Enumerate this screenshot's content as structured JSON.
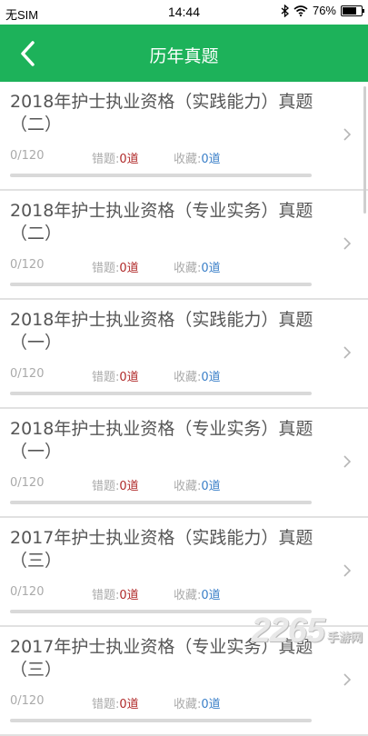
{
  "status": {
    "carrier": "无SIM",
    "time": "14:44",
    "battery": "76%",
    "battery_level": 0.76
  },
  "nav": {
    "title": "历年真题"
  },
  "list": {
    "wrong_label": "错题:",
    "fav_label": "收藏:",
    "items": [
      {
        "title": "2018年护士执业资格（实践能力）真题（二）",
        "progress": "0/120",
        "wrong": "0道",
        "fav": "0道"
      },
      {
        "title": "2018年护士执业资格（专业实务）真题（二）",
        "progress": "0/120",
        "wrong": "0道",
        "fav": "0道"
      },
      {
        "title": "2018年护士执业资格（实践能力）真题（一）",
        "progress": "0/120",
        "wrong": "0道",
        "fav": "0道"
      },
      {
        "title": "2018年护士执业资格（专业实务）真题（一）",
        "progress": "0/120",
        "wrong": "0道",
        "fav": "0道"
      },
      {
        "title": "2017年护士执业资格（实践能力）真题（三）",
        "progress": "0/120",
        "wrong": "0道",
        "fav": "0道"
      },
      {
        "title": "2017年护士执业资格（专业实务）真题（三）",
        "progress": "0/120",
        "wrong": "0道",
        "fav": "0道"
      }
    ]
  },
  "watermark": {
    "number": "2265",
    "suffix": ".com",
    "name": "手游网"
  },
  "colors": {
    "accent": "#1db25a",
    "wrong": "#b02a2a",
    "fav": "#3a7fc8"
  }
}
